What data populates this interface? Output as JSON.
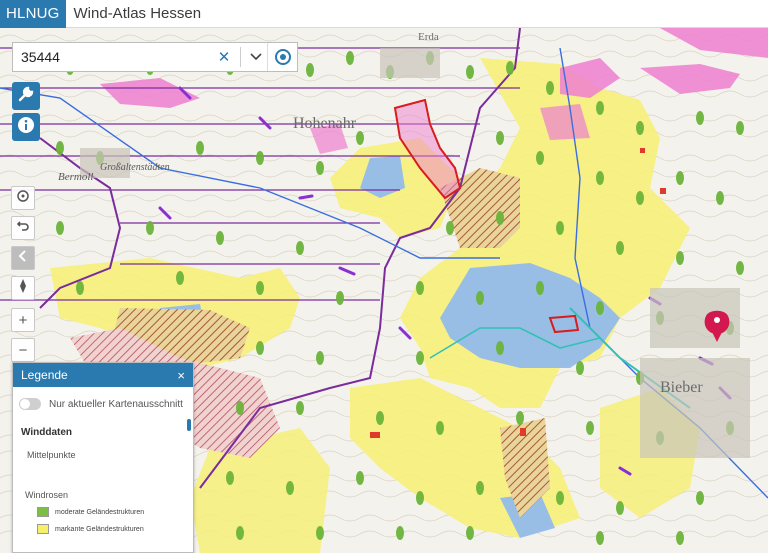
{
  "header": {
    "brand": "HLNUG",
    "title": "Wind-Atlas Hessen"
  },
  "search": {
    "value": "35444",
    "clear_icon": "close-icon",
    "dropdown_icon": "chevron-down-icon",
    "locate_icon": "locate-icon"
  },
  "tools": [
    {
      "name": "settings-button",
      "icon": "wrench-icon"
    },
    {
      "name": "info-button",
      "icon": "info-icon"
    }
  ],
  "controls": [
    {
      "name": "rotate",
      "icon": "rotate-icon"
    },
    {
      "name": "undo",
      "icon": "undo-icon"
    },
    {
      "name": "collapse",
      "icon": "chevron-left-icon"
    },
    {
      "name": "compass",
      "icon": "compass-icon"
    },
    {
      "name": "zoom-in",
      "label": "+"
    },
    {
      "name": "zoom-out",
      "label": "−"
    }
  ],
  "map_labels": {
    "place1": "Hohenahr",
    "place2": "Großaltenstädten",
    "place3": "Bermoll",
    "place4": "Bieber",
    "place5": "Erda"
  },
  "legend": {
    "title": "Legende",
    "close": "×",
    "toggle_label": "Nur aktueller Kartenausschnitt",
    "section1": "Winddaten",
    "sub1": "Mittelpunkte",
    "section2": "Windrosen",
    "items": [
      {
        "label": "moderate Geländestrukturen",
        "color": "#7bbf45"
      },
      {
        "label": "markante Geländestrukturen",
        "color": "#f5f06a"
      }
    ]
  },
  "colors": {
    "accent": "#2a7ab0",
    "marker": "#d3174f"
  }
}
